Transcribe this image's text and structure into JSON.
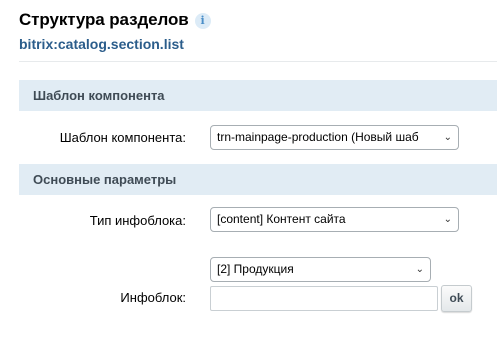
{
  "header": {
    "title": "Структура разделов",
    "info_icon": "info-icon",
    "component_code": "bitrix:catalog.section.list"
  },
  "sections": {
    "template": {
      "title": "Шаблон компонента",
      "field_label": "Шаблон компонента:",
      "field_value": "trn-mainpage-production (Новый шаб"
    },
    "main": {
      "title": "Основные параметры",
      "iblock_type_label": "Тип инфоблока:",
      "iblock_type_value": "[content] Контент сайта",
      "iblock_label": "Инфоблок:",
      "iblock_select_value": "[2] Продукция",
      "iblock_input_value": "",
      "ok_label": "ok"
    }
  },
  "icons": {
    "dropdown": "chevron-down-icon"
  },
  "colors": {
    "section_bg": "#e1ecf4",
    "subtitle": "#2b5d8b",
    "info_icon": "#4a8ec8"
  }
}
